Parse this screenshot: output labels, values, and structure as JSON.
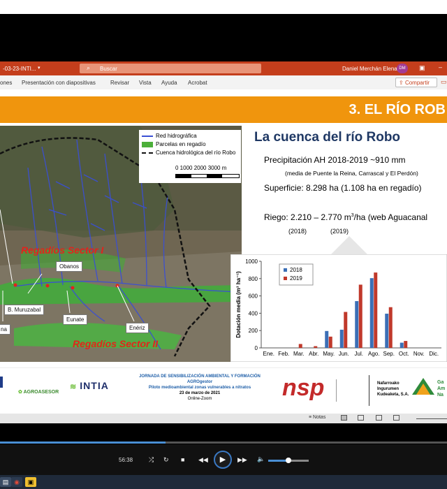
{
  "titlebar": {
    "doc_title": "-03-23-INTI...",
    "search_placeholder": "Buscar",
    "user_name": "Daniel Merchán Elena",
    "user_initials": "DM"
  },
  "ribbon": {
    "tabs": [
      "ones",
      "Presentación con diapositivas",
      "Revisar",
      "Vista",
      "Ayuda",
      "Acrobat"
    ],
    "share_label": "Compartir"
  },
  "slide": {
    "banner_title": "3. EL RÍO ROB",
    "legend": {
      "items": [
        "Red hidrográfica",
        "Parcelas en regadío",
        "Cuenca hidrológica del río Robo"
      ],
      "scale_text": "0   1000  2000  3000 m"
    },
    "map_labels": {
      "obanos": "Obanos",
      "muruzabal": "B. Muruzabal",
      "eunate": "Eunate",
      "eneriz": "Enériz",
      "left_cut": "na",
      "sector1": "Regadíos Sector I",
      "sector2": "Regadíos Sector II"
    },
    "heading": "La cuenca del río Robo",
    "precip": "Precipitación AH 2018-2019  ~910 mm",
    "precip_note": "(media de Puente la Reina, Carrascal y El Perdón)",
    "surface": "Superficie: 8.298 ha (1.108 ha en regadío)",
    "riego_prefix": "Riego: 2.210 – 2.770 m",
    "riego_sup": "3",
    "riego_suffix": "/ha (web Aguacanal",
    "year_a": "(2018)",
    "year_b": "(2019)"
  },
  "chart_data": {
    "type": "bar",
    "categories": [
      "Ene.",
      "Feb.",
      "Mar.",
      "Abr.",
      "May.",
      "Jun.",
      "Jul.",
      "Ago.",
      "Sep.",
      "Oct.",
      "Nov.",
      "Dic."
    ],
    "series": [
      {
        "name": "2018",
        "values": [
          0,
          0,
          0,
          0,
          195,
          210,
          540,
          805,
          395,
          60,
          0,
          0
        ],
        "color": "#3b6fb6"
      },
      {
        "name": "2019",
        "values": [
          0,
          0,
          45,
          20,
          130,
          415,
          730,
          870,
          470,
          80,
          0,
          0
        ],
        "color": "#c0392b"
      }
    ],
    "ylabel": "Dotación media (m³ ha⁻¹)",
    "ylim": [
      0,
      1000
    ],
    "yticks": [
      0,
      200,
      400,
      600,
      800,
      1000
    ],
    "legend_position": "top-left"
  },
  "footer": {
    "agroasesor": "AGROASESOR",
    "intia": "INTIA",
    "jornada_title": "JORNADA DE SENSIBILIZACIÓN AMBIENTAL Y FORMACIÓN",
    "jornada_org": "AGROgestor",
    "jornada_sub": "Piloto medioambiental zonas vulnerables a nitratos",
    "jornada_date": "23 de marzo de 2021",
    "jornada_mode": "Online-Zoom",
    "nsp": "nsp",
    "nasuvinsa": [
      "Nafarroako",
      "Ingurumen",
      "Kudeaketa, S.A."
    ],
    "gan": [
      "Ga",
      "Am",
      "Na"
    ]
  },
  "statusbar": {
    "notas": "Notas"
  },
  "video": {
    "time": "56:38",
    "progress": 0.37,
    "volume": 0.5
  },
  "colors": {
    "accent_orange": "#f0950d",
    "ppt_red": "#c43e1c",
    "heading_blue": "#1f3864",
    "series_2018": "#3b6fb6",
    "series_2019": "#c0392b"
  }
}
